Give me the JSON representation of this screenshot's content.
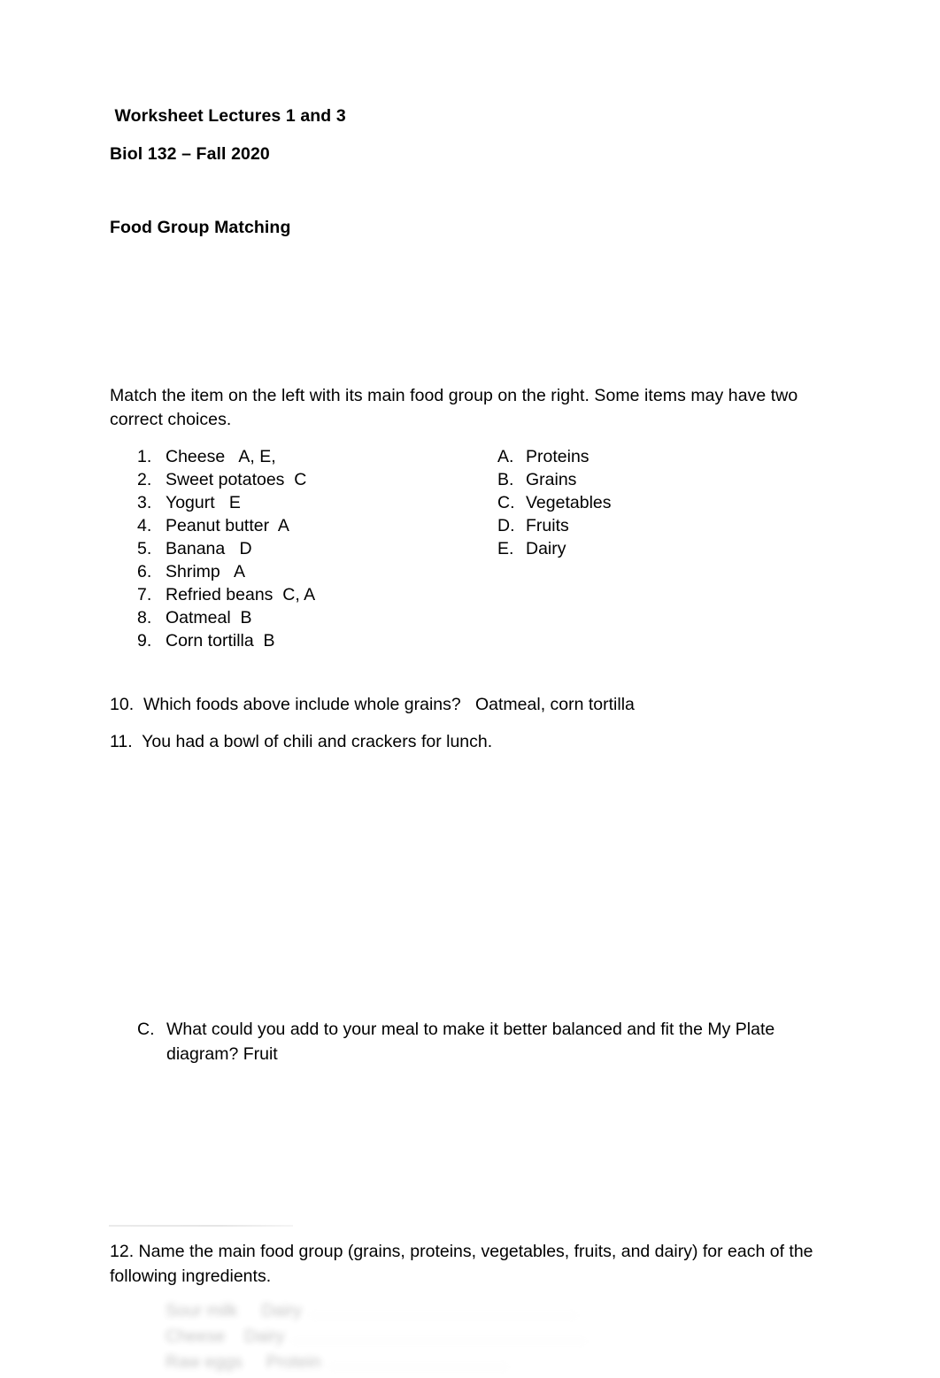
{
  "document": {
    "title": " Worksheet Lectures 1 and 3",
    "subtitle": "Biol 132 – Fall 2020",
    "section_heading": "Food Group Matching",
    "instructions": "Match the item on the left with its main food group on the right.  Some items may have two correct choices."
  },
  "matching": {
    "items": [
      {
        "marker": "1.",
        "text": "Cheese   A, E,"
      },
      {
        "marker": "2.",
        "text": "Sweet potatoes  C"
      },
      {
        "marker": "3.",
        "text": "Yogurt   E"
      },
      {
        "marker": "4.",
        "text": "Peanut butter  A"
      },
      {
        "marker": "5.",
        "text": "Banana   D"
      },
      {
        "marker": "6.",
        "text": "Shrimp   A"
      },
      {
        "marker": "7.",
        "text": "Refried beans  C, A"
      },
      {
        "marker": "8.",
        "text": "Oatmeal  B"
      },
      {
        "marker": "9.",
        "text": "Corn tortilla  B"
      }
    ],
    "groups": [
      {
        "marker": "A.",
        "text": "Proteins"
      },
      {
        "marker": "B.",
        "text": "Grains"
      },
      {
        "marker": "C.",
        "text": "Vegetables"
      },
      {
        "marker": "D.",
        "text": "Fruits"
      },
      {
        "marker": "E.",
        "text": "Dairy"
      }
    ]
  },
  "questions": {
    "q10": "10.  Which foods above include whole grains?   Oatmeal, corn tortilla",
    "q11": "11.  You had a bowl of chili and crackers for lunch.",
    "q11c_marker": "C.",
    "q11c_text": "What could you add to your meal to make it better balanced and fit the My Plate diagram?    Fruit",
    "q12": "12. Name the main food group (grains, proteins, vegetables, fruits, and dairy) for each of the following ingredients."
  },
  "obscured": {
    "note": "illegible",
    "rows": [
      {
        "marker": "",
        "text": "Sour milk     Dairy"
      },
      {
        "marker": "",
        "text": "Cheese    Dairy"
      },
      {
        "marker": "",
        "text": "Raw eggs     Protein"
      }
    ]
  }
}
